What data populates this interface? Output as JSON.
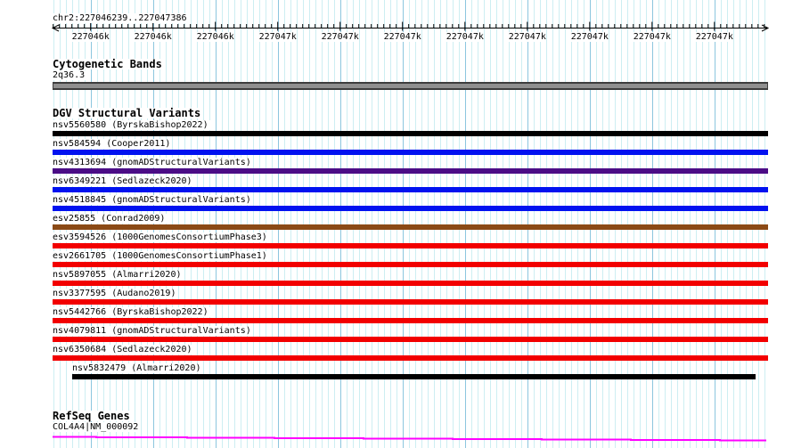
{
  "ruler": {
    "title": "chr2:227046239..227047386",
    "region_start": 227046239,
    "region_end": 227047386,
    "minor_step_bp": 10,
    "major_step_bp": 100,
    "tick_labels": [
      "227046k",
      "227046k",
      "227046k",
      "227047k",
      "227047k",
      "227047k",
      "227047k",
      "227047k",
      "227047k",
      "227047k",
      "227047k"
    ]
  },
  "cytobands": {
    "header": "Cytogenetic Bands",
    "band_label": "2q36.3"
  },
  "dgv": {
    "header": "DGV Structural Variants",
    "variants": [
      {
        "label": "nsv5560580 (ByrskaBishop2022)",
        "color": "black"
      },
      {
        "label": "nsv584594 (Cooper2011)",
        "color": "blue"
      },
      {
        "label": "nsv4313694 (gnomADStructuralVariants)",
        "color": "purple"
      },
      {
        "label": "nsv6349221 (Sedlazeck2020)",
        "color": "blue"
      },
      {
        "label": "nsv4518845 (gnomADStructuralVariants)",
        "color": "blue"
      },
      {
        "label": "esv25855 (Conrad2009)",
        "color": "brown"
      },
      {
        "label": "esv3594526 (1000GenomesConsortiumPhase3)",
        "color": "red"
      },
      {
        "label": "esv2661705 (1000GenomesConsortiumPhase1)",
        "color": "red"
      },
      {
        "label": "nsv5897055 (Almarri2020)",
        "color": "red"
      },
      {
        "label": "nsv3377595 (Audano2019)",
        "color": "red"
      },
      {
        "label": "nsv5442766 (ByrskaBishop2022)",
        "color": "red"
      },
      {
        "label": "nsv4079811 (gnomADStructuralVariants)",
        "color": "red"
      },
      {
        "label": "nsv6350684 (Sedlazeck2020)",
        "color": "red"
      },
      {
        "label": "nsv5832479 (Almarri2020)",
        "color": "black",
        "indent": true
      }
    ]
  },
  "refseq": {
    "header": "RefSeq Genes",
    "gene_label": "COL4A4|NM_000092",
    "line_steps": [
      [
        59,
        108,
        490.5
      ],
      [
        108,
        210,
        491
      ],
      [
        210,
        308,
        491.5
      ],
      [
        308,
        408,
        492
      ],
      [
        408,
        508,
        492.5
      ],
      [
        508,
        608,
        493
      ],
      [
        608,
        708,
        493.5
      ],
      [
        708,
        808,
        494
      ],
      [
        808,
        860,
        494.5
      ]
    ]
  },
  "colors": {
    "grid_minor": "#cdeef2",
    "grid_major": "#8cc6de",
    "axis": "#000000",
    "band_fill": "#8f8f8f",
    "band_border": "#3d3d3d",
    "gene_line": "#ff00ff",
    "black": "#000000",
    "blue": "#0012f0",
    "purple": "#4b0d86",
    "brown": "#8b4a16",
    "red": "#f20000"
  }
}
